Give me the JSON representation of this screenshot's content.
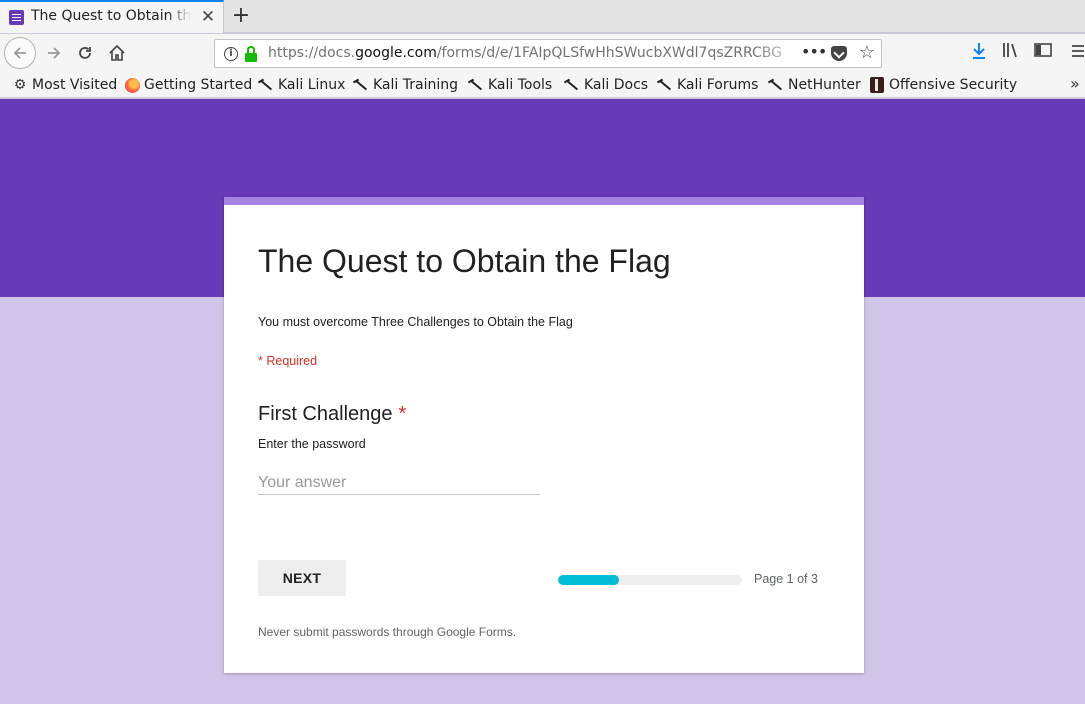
{
  "browser": {
    "tab": {
      "title": "The Quest to Obtain the Flag",
      "favicon": "google-forms-icon",
      "close_symbol": "✕"
    },
    "new_tab_symbol": "+",
    "url": {
      "prefix": "https://docs.",
      "host": "google.com",
      "path": "/forms/d/e/1FAIpQLSfwHhSWucbXWdl7qsZRRCBG"
    },
    "bookmarks": [
      {
        "label": "Most Visited",
        "icon": "gear-icon"
      },
      {
        "label": "Getting Started",
        "icon": "firefox-icon"
      },
      {
        "label": "Kali Linux",
        "icon": "kali-icon"
      },
      {
        "label": "Kali Training",
        "icon": "kali-icon"
      },
      {
        "label": "Kali Tools",
        "icon": "kali-icon"
      },
      {
        "label": "Kali Docs",
        "icon": "kali-icon"
      },
      {
        "label": "Kali Forums",
        "icon": "kali-icon"
      },
      {
        "label": "NetHunter",
        "icon": "kali-icon"
      },
      {
        "label": "Offensive Security",
        "icon": "offsec-icon"
      }
    ]
  },
  "form": {
    "title": "The Quest to Obtain the Flag",
    "description": "You must overcome Three Challenges to Obtain the Flag",
    "required_note": "* Required",
    "question": {
      "title": "First Challenge",
      "required_mark": "*",
      "help": "Enter the password",
      "placeholder": "Your answer",
      "value": ""
    },
    "next_label": "NEXT",
    "progress": {
      "fraction": 0.333,
      "label": "Page 1 of 3"
    },
    "footer": "Never submit passwords through Google Forms."
  },
  "colors": {
    "header_band": "#673ab7",
    "page_bg": "#d1c4e9",
    "card_accent": "#a484e0",
    "progress_fill": "#00bcd4",
    "required": "#d93025"
  }
}
